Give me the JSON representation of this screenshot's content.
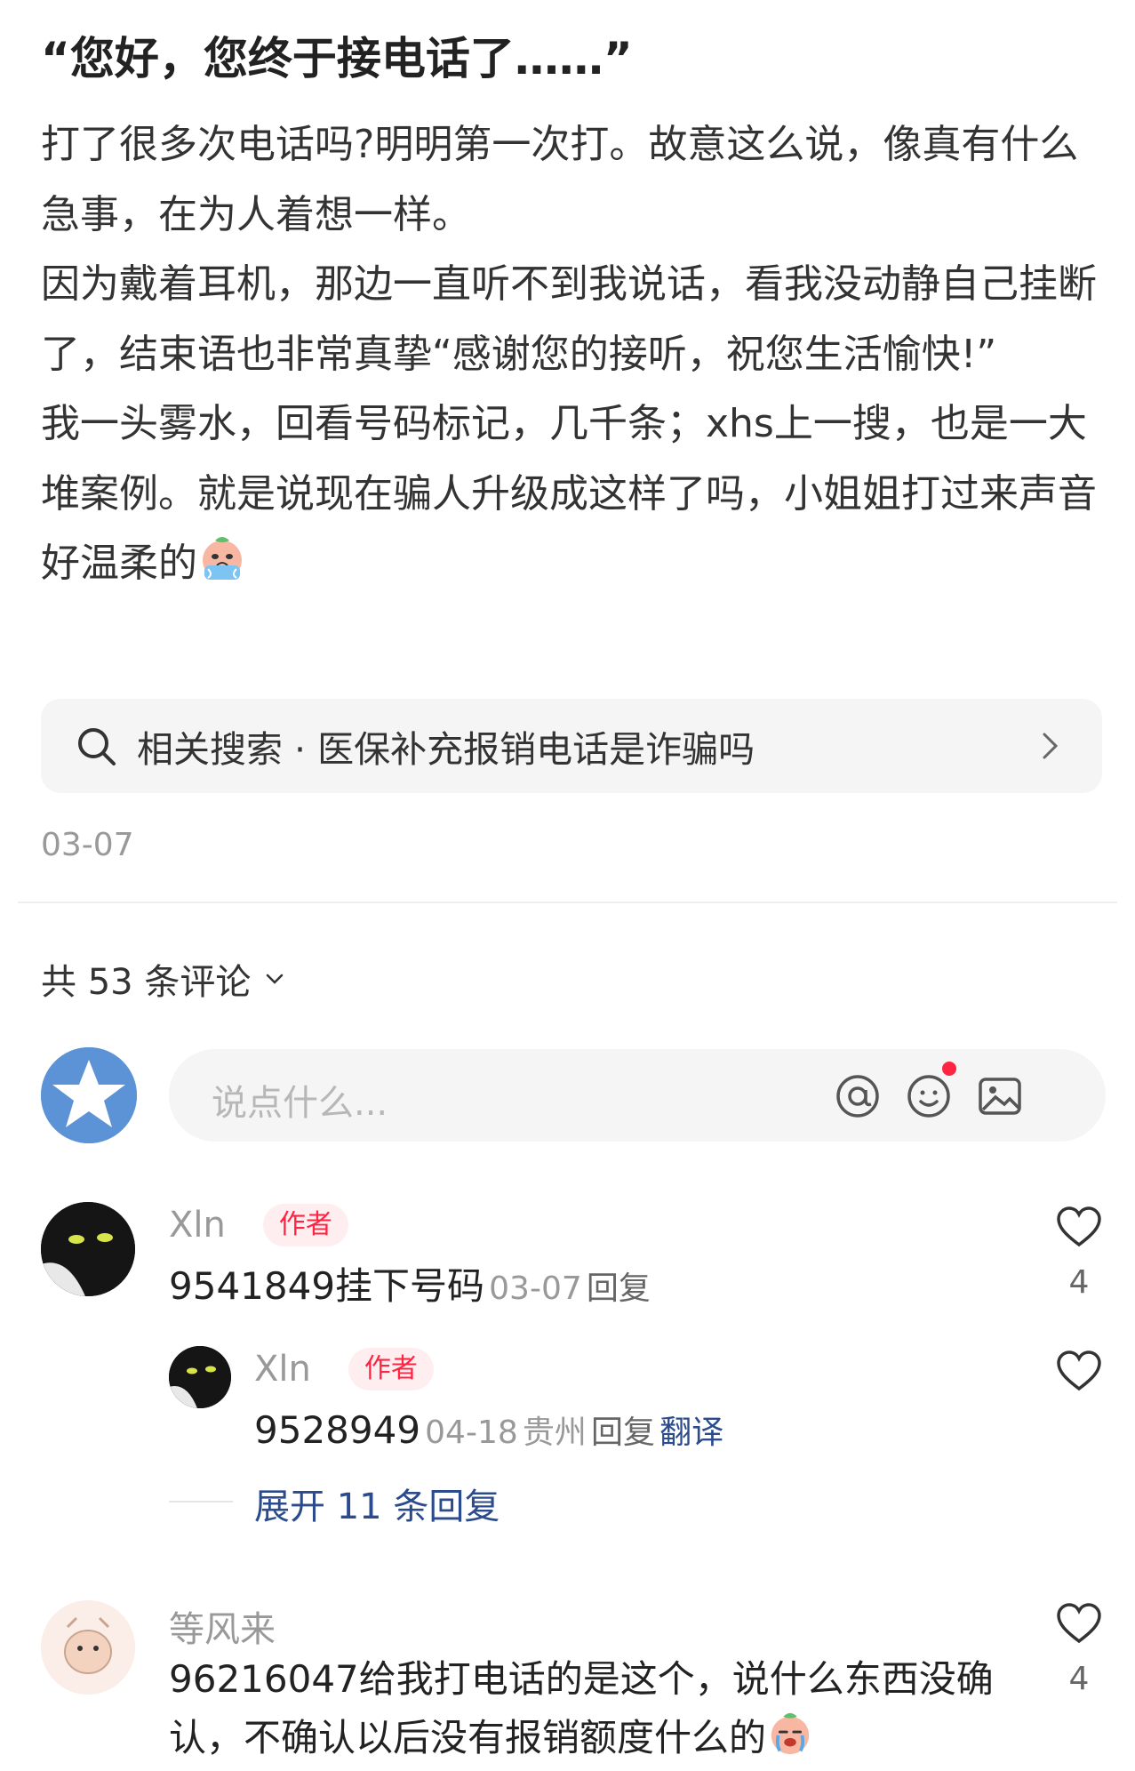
{
  "post": {
    "title": "“您好，您终于接电话了……”",
    "paragraphs": [
      "打了很多次电话吗?明明第一次打。故意这么说，像真有什么急事，在为人着想一样。",
      "因为戴着耳机，那边一直听不到我说话，看我没动静自己挂断了，结束语也非常真挚“感谢您的接听，祝您生活愉快!”",
      "我一头雾水，回看号码标记，几千条；xhs上一搜，也是一大堆案例。就是说现在骗人升级成这样了吗，小姐姐打过来声音好温柔的"
    ],
    "date": "03-07"
  },
  "related_search": {
    "label": "相关搜索 · 医保补充报销电话是诈骗吗"
  },
  "comments_header": {
    "count_label": "共 53 条评论"
  },
  "composer": {
    "placeholder": "说点什么..."
  },
  "comments": [
    {
      "name": "Xln",
      "badge": "作者",
      "text": "9541849挂下号码",
      "date": "03-07",
      "reply": "回复",
      "likes": "4"
    }
  ],
  "sub_reply": {
    "name": "Xln",
    "badge": "作者",
    "text": "9528949",
    "date": "04-18",
    "location": "贵州",
    "reply": "回复",
    "translate": "翻译"
  },
  "expand_label": "展开 11 条回复",
  "comment2": {
    "name": "等风来",
    "text": "96216047给我打电话的是这个，说什么东西没确认，不确认以后没有报销额度什么的",
    "likes": "4"
  },
  "colors": {
    "accent_red": "#ff2442",
    "link_blue": "#2b4b8c",
    "muted": "#999999"
  }
}
